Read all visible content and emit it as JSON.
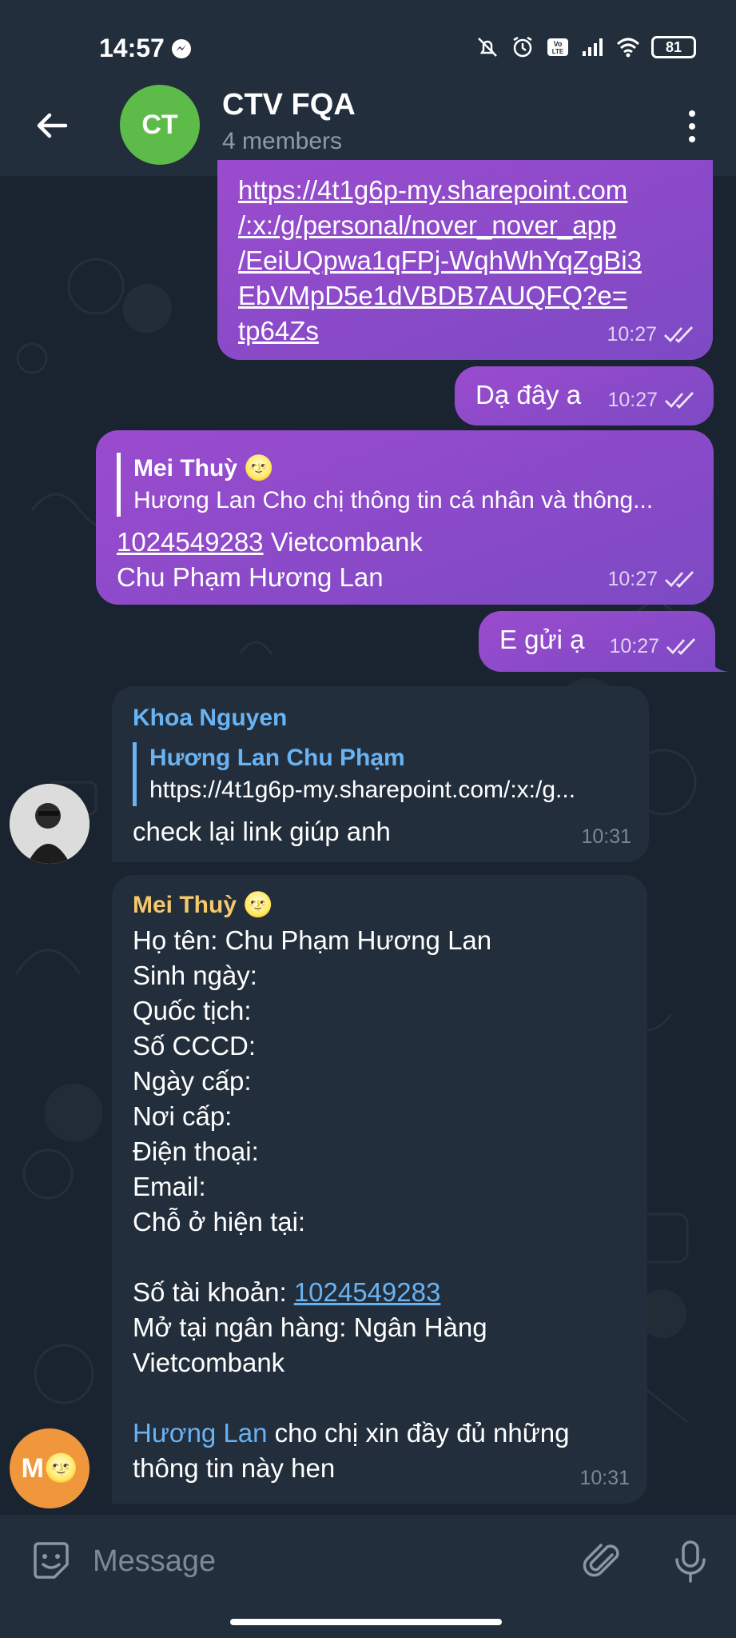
{
  "status": {
    "time": "14:57",
    "battery": "81"
  },
  "header": {
    "avatar_initials": "CT",
    "title": "CTV FQA",
    "subtitle": "4 members"
  },
  "messages": [
    {
      "link_lines": [
        "https://4t1g6p-my.sharepoint.com",
        "/:x:/g/personal/nover_nover_app",
        "/EeiUQpwa1qFPj-WqhWhYqZgBi3",
        "EbVMpD5e1dVBDB7AUQFQ?e=",
        "tp64Zs"
      ],
      "time": "10:27"
    },
    {
      "text": "Dạ đây a",
      "time": "10:27"
    },
    {
      "reply_name": "Mei Thuỳ 🌝",
      "reply_text": "Hương Lan Cho chị thông tin cá nhân và thông...",
      "account_number": "1024549283",
      "line1_rest": " Vietcombank",
      "line2": "Chu Phạm Hương Lan",
      "time": "10:27"
    },
    {
      "text": "E gửi ạ",
      "time": "10:27"
    },
    {
      "sender": "Khoa Nguyen",
      "reply_name": "Hương Lan Chu Phạm",
      "reply_text": "https://4t1g6p-my.sharepoint.com/:x:/g...",
      "text": "check lại link giúp anh",
      "time": "10:31"
    },
    {
      "sender": "Mei Thuỳ 🌝",
      "lines": [
        "Họ tên: Chu Phạm Hương Lan",
        "Sinh ngày:",
        "Quốc tịch:",
        "Số CCCD:",
        "Ngày cấp:",
        "Nơi cấp:",
        "Điện thoại:",
        "Email:",
        "Chỗ ở hiện tại:"
      ],
      "account_label": "Số tài khoản: ",
      "account_number": "1024549283",
      "bank_line1": "Mở tại ngân hàng: Ngân Hàng",
      "bank_line2": "Vietcombank",
      "mention": "Hương Lan",
      "closing_rest": " cho chị xin đầy đủ những",
      "closing_line2": "thông tin này hen",
      "time": "10:31",
      "avatar_initial": "M🌝"
    }
  ],
  "input": {
    "placeholder": "Message"
  },
  "colors": {
    "outgoing_bubble": "#8d48c9",
    "incoming_bubble": "#222e3b",
    "link_blue": "#6ab3f3",
    "sender_khoa": "#6ab3f3",
    "sender_mei": "#f5c86b",
    "avatar_green": "#5dbb4a",
    "avatar_orange": "#f0973d"
  }
}
